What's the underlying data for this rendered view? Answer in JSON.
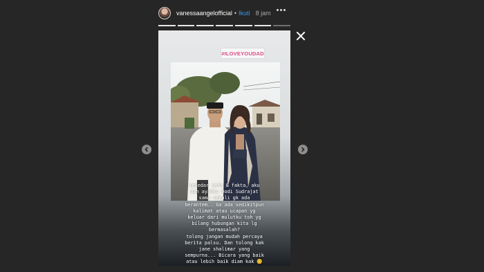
{
  "header": {
    "username": "vanessaangelofficial",
    "separator": "•",
    "follow_label": "Ikuti",
    "time": "8 jam"
  },
  "story": {
    "sticker": "#ILOVEYOUDAD",
    "caption_lines": [
      "sekedar info & fakta, aku",
      "dan ayahku Dodi Sudrajat",
      "sama sekali gk ada",
      "berantem.. Ga ada sedikitpun",
      "kalimat atau ucapan yg",
      "keluar dari mulutku toh yg",
      "bilang hubungan kita lg",
      "bermasalah?",
      "tolong jangan mudah percaya",
      "berita palsu. Dan tolong kak",
      "jane shalimar yang",
      "sempurna... Bicara yang baik",
      "atau lebih baik diam kak 😊"
    ],
    "progress_segments": 7,
    "progress_completed": 6
  },
  "icons": {
    "close": "close-icon",
    "more": "more-icon",
    "prev": "chevron-left-icon",
    "next": "chevron-right-icon"
  },
  "colors": {
    "background": "#262626",
    "follow": "#3897f0",
    "sticker_text": "#d94b82"
  }
}
